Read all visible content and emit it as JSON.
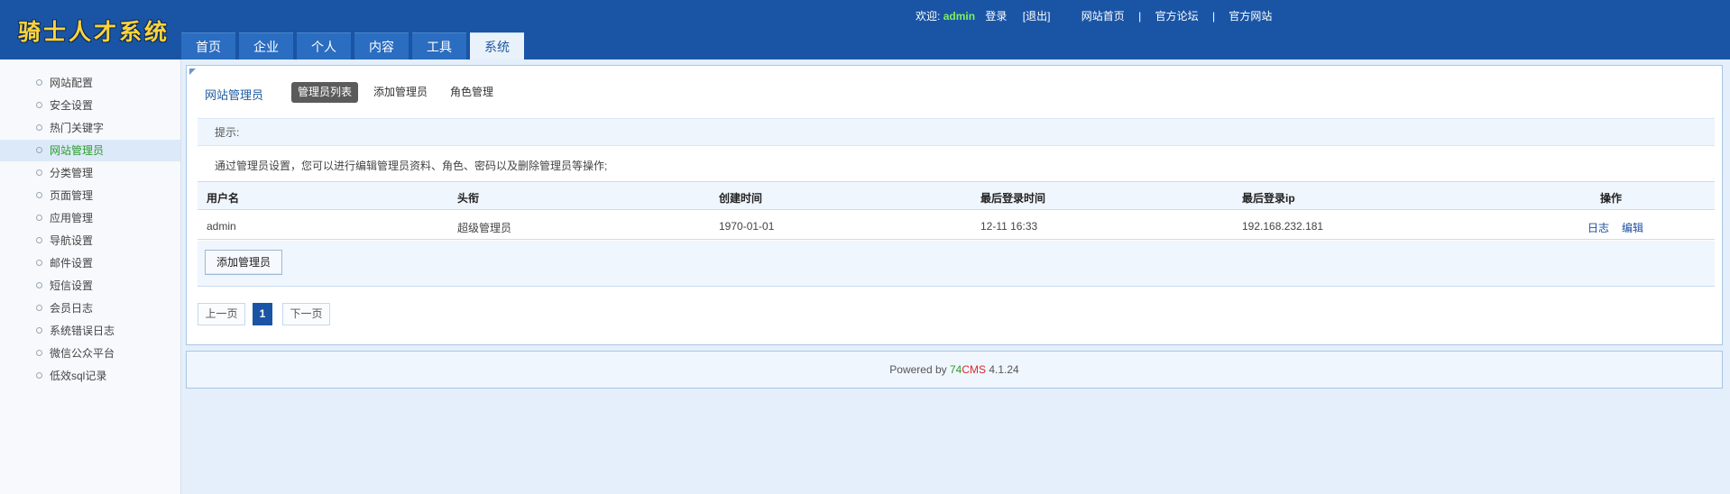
{
  "app": {
    "logo": "骑士人才系统"
  },
  "topbar": {
    "welcome": "欢迎:",
    "username": "admin",
    "login": "登录",
    "logout": "[退出]",
    "links": [
      "网站首页",
      "官方论坛",
      "官方网站"
    ],
    "separator": "|"
  },
  "nav": {
    "tabs": [
      {
        "label": "首页",
        "active": false
      },
      {
        "label": "企业",
        "active": false
      },
      {
        "label": "个人",
        "active": false
      },
      {
        "label": "内容",
        "active": false
      },
      {
        "label": "工具",
        "active": false
      },
      {
        "label": "系统",
        "active": true
      }
    ]
  },
  "sidebar": {
    "items": [
      {
        "label": "网站配置",
        "active": false
      },
      {
        "label": "安全设置",
        "active": false
      },
      {
        "label": "热门关键字",
        "active": false
      },
      {
        "label": "网站管理员",
        "active": true
      },
      {
        "label": "分类管理",
        "active": false
      },
      {
        "label": "页面管理",
        "active": false
      },
      {
        "label": "应用管理",
        "active": false
      },
      {
        "label": "导航设置",
        "active": false
      },
      {
        "label": "邮件设置",
        "active": false
      },
      {
        "label": "短信设置",
        "active": false
      },
      {
        "label": "会员日志",
        "active": false
      },
      {
        "label": "系统错误日志",
        "active": false
      },
      {
        "label": "微信公众平台",
        "active": false
      },
      {
        "label": "低效sql记录",
        "active": false
      }
    ]
  },
  "main": {
    "title": "网站管理员",
    "subtabs": [
      {
        "label": "管理员列表",
        "active": true
      },
      {
        "label": "添加管理员",
        "active": false
      },
      {
        "label": "角色管理",
        "active": false
      }
    ],
    "tip_label": "提示:",
    "tip_text": "通过管理员设置，您可以进行编辑管理员资料、角色、密码以及删除管理员等操作;",
    "table": {
      "headers": [
        "用户名",
        "头衔",
        "创建时间",
        "最后登录时间",
        "最后登录ip",
        "操作"
      ],
      "rows": [
        {
          "username": "admin",
          "title": "超级管理员",
          "created": "1970-01-01",
          "last_login": "12-11 16:33",
          "last_ip": "192.168.232.181",
          "actions": [
            "日志",
            "编辑"
          ]
        }
      ]
    },
    "add_button": "添加管理员",
    "pager": {
      "prev": "上一页",
      "current": "1",
      "next": "下一页"
    }
  },
  "footer": {
    "powered": "Powered by",
    "brand_74": "74",
    "brand_cms": "CMS",
    "version": "4.1.24"
  },
  "colors": {
    "header": "#1a55a5",
    "accent_green": "#2c9c2c",
    "accent_red": "#d62b2b",
    "link_blue": "#1d4fa0"
  }
}
